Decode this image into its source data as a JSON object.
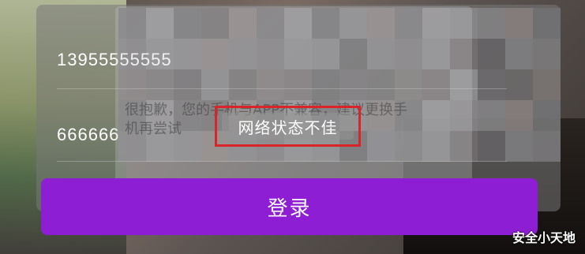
{
  "form": {
    "phone_value": "13955555555",
    "code_value": "666666",
    "login_label": "登录"
  },
  "dialog": {
    "apology_text": "很抱歉，您的手机与APP不兼容，建议更换手机再尝试"
  },
  "toast": {
    "message": "网络状态不佳"
  },
  "watermark": "安全小天地",
  "colors": {
    "login_button": "#8e1ed4",
    "toast_highlight": "#d9252a"
  }
}
